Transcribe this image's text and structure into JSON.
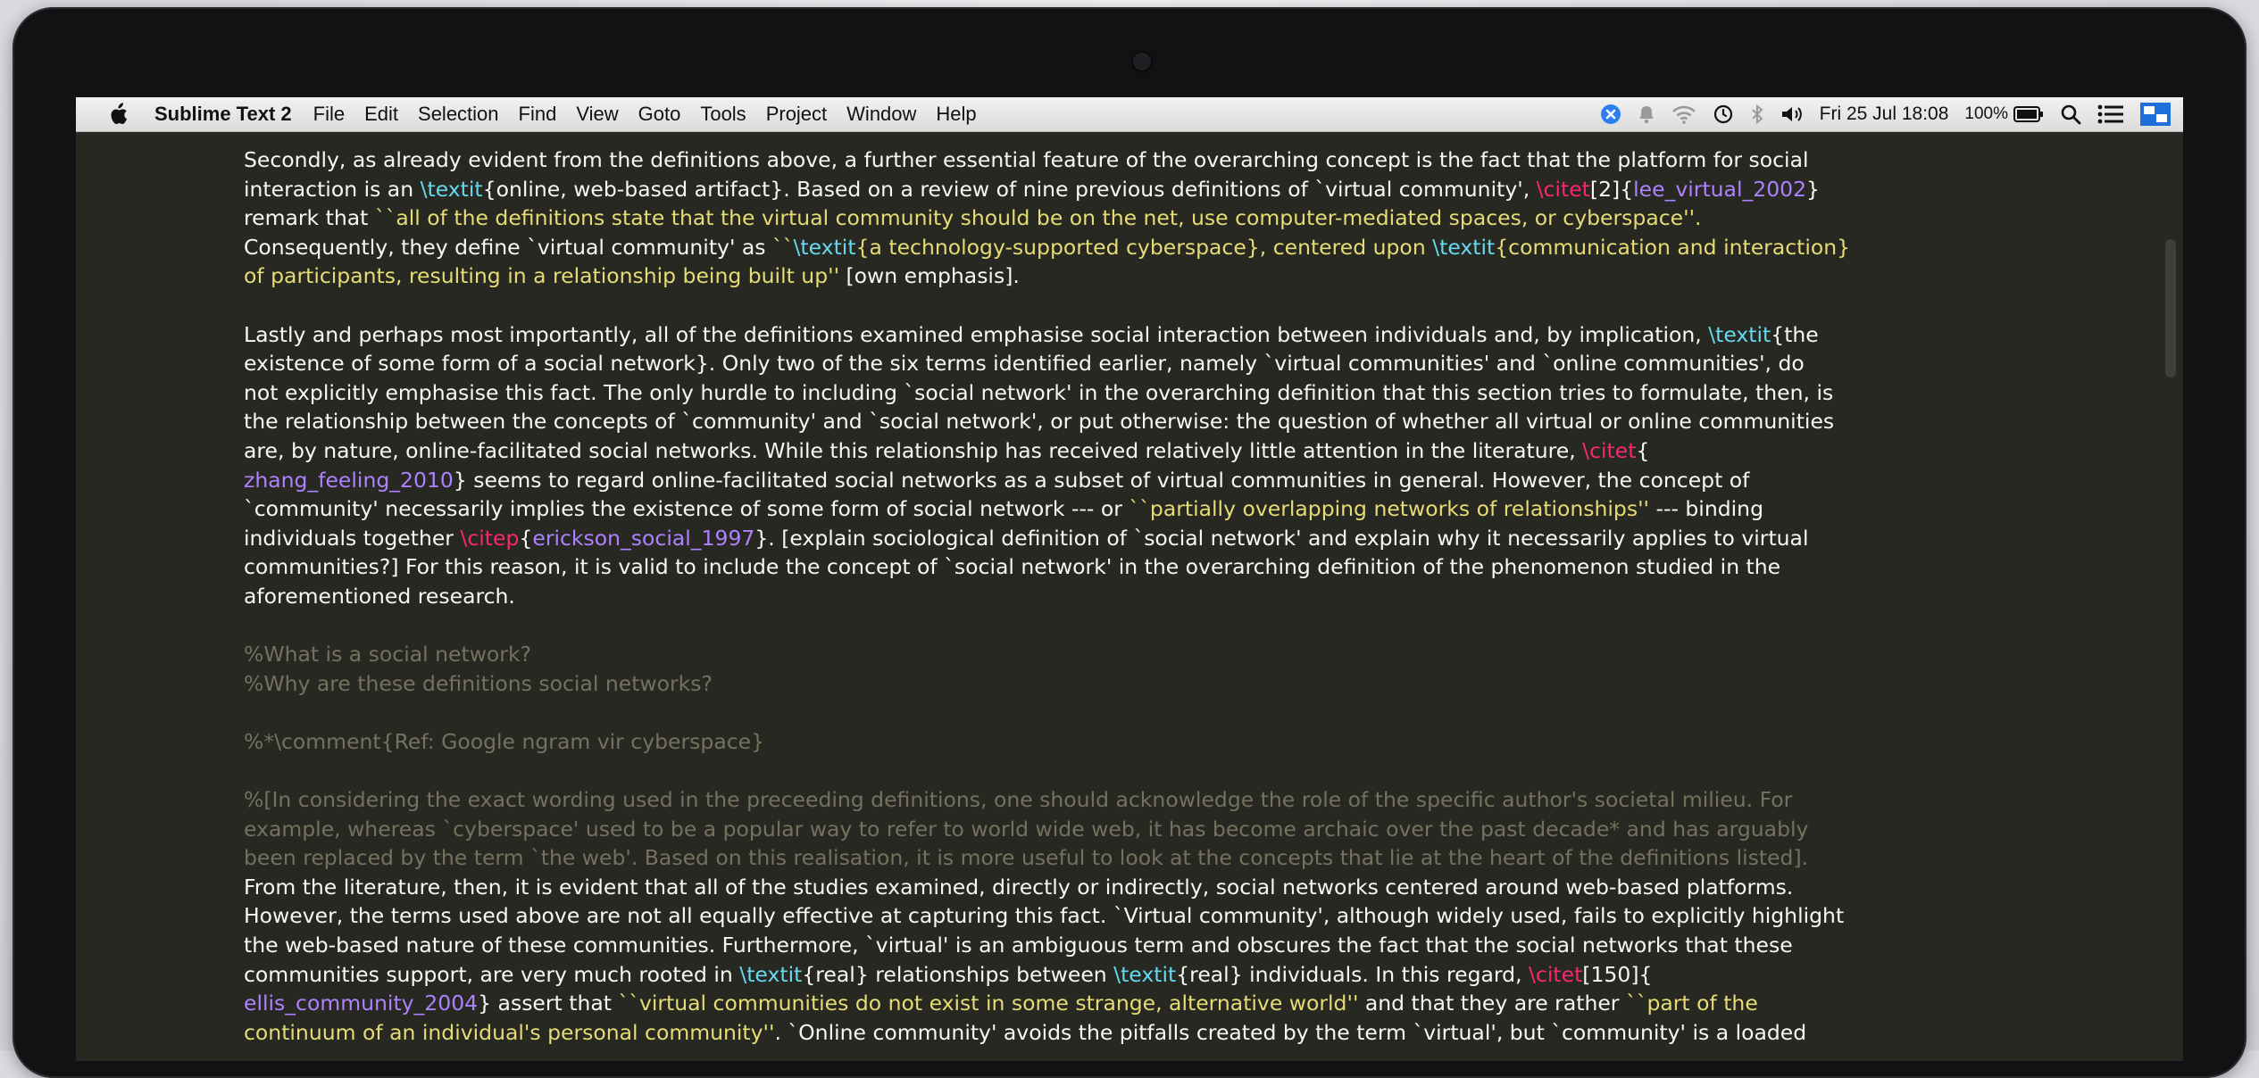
{
  "menubar": {
    "app_name": "Sublime Text 2",
    "items": [
      "File",
      "Edit",
      "Selection",
      "Find",
      "View",
      "Goto",
      "Tools",
      "Project",
      "Window",
      "Help"
    ],
    "clock": "Fri 25 Jul  18:08",
    "battery": "100%"
  },
  "editor": {
    "paragraphs": [
      [
        [
          {
            "t": "text",
            "v": "Secondly, as already evident from the definitions above, a further essential feature of the overarching concept is the fact that the platform for social"
          }
        ],
        [
          {
            "t": "text",
            "v": "interaction is an "
          },
          {
            "t": "cmd",
            "v": "\\textit"
          },
          {
            "t": "text",
            "v": "{online, web-based artifact}. Based on a review of nine previous definitions of `virtual community', "
          },
          {
            "t": "cite",
            "v": "\\citet"
          },
          {
            "t": "text",
            "v": "[2]{"
          },
          {
            "t": "key",
            "v": "lee_virtual_2002"
          },
          {
            "t": "text",
            "v": "}"
          }
        ],
        [
          {
            "t": "text",
            "v": "remark that "
          },
          {
            "t": "str",
            "v": "``all of the definitions state that the virtual community should be on the net, use computer-mediated spaces, or cyberspace''."
          }
        ],
        [
          {
            "t": "text",
            "v": "Consequently, they define `virtual community' as "
          },
          {
            "t": "str",
            "v": "``"
          },
          {
            "t": "cmd",
            "v": "\\textit"
          },
          {
            "t": "str",
            "v": "{a technology-supported cyberspace}, centered upon "
          },
          {
            "t": "cmd",
            "v": "\\textit"
          },
          {
            "t": "str",
            "v": "{communication and interaction}"
          }
        ],
        [
          {
            "t": "str",
            "v": "of participants, resulting in a relationship being built up''"
          },
          {
            "t": "text",
            "v": " [own emphasis]."
          }
        ]
      ],
      [
        [
          {
            "t": "text",
            "v": "Lastly and perhaps most importantly, all of the definitions examined emphasise social interaction between individuals and, by implication, "
          },
          {
            "t": "cmd",
            "v": "\\textit"
          },
          {
            "t": "text",
            "v": "{the"
          }
        ],
        [
          {
            "t": "text",
            "v": "existence of some form of a social network}. Only two of the six terms identified earlier, namely `virtual communities' and `online communities', do"
          }
        ],
        [
          {
            "t": "text",
            "v": "not explicitly emphasise this fact. The only hurdle to including `social network' in the overarching definition that this section tries to formulate, then, is"
          }
        ],
        [
          {
            "t": "text",
            "v": "the relationship between the concepts of `community' and `social network', or put otherwise: the question of whether all virtual or online communities"
          }
        ],
        [
          {
            "t": "text",
            "v": "are, by nature, online-facilitated social networks. While this relationship has received relatively little attention in the literature, "
          },
          {
            "t": "cite",
            "v": "\\citet"
          },
          {
            "t": "text",
            "v": "{"
          }
        ],
        [
          {
            "t": "key",
            "v": "zhang_feeling_2010"
          },
          {
            "t": "text",
            "v": "} seems to regard online-facilitated social networks as a subset of virtual communities in general. However, the concept of"
          }
        ],
        [
          {
            "t": "text",
            "v": "`community' necessarily implies the existence of some form of social network --- or "
          },
          {
            "t": "str",
            "v": "``partially overlapping networks of relationships''"
          },
          {
            "t": "text",
            "v": " --- binding"
          }
        ],
        [
          {
            "t": "text",
            "v": "individuals together "
          },
          {
            "t": "cite",
            "v": "\\citep"
          },
          {
            "t": "text",
            "v": "{"
          },
          {
            "t": "key",
            "v": "erickson_social_1997"
          },
          {
            "t": "text",
            "v": "}. [explain sociological definition of `social network' and explain why it necessarily applies to virtual"
          }
        ],
        [
          {
            "t": "text",
            "v": "communities?] For this reason, it is valid to include the concept of `social network' in the overarching definition of the phenomenon studied in the"
          }
        ],
        [
          {
            "t": "text",
            "v": "aforementioned research."
          }
        ]
      ],
      [
        [
          {
            "t": "comment",
            "v": "%What is a social network?"
          }
        ],
        [
          {
            "t": "comment",
            "v": "%Why are these definitions social networks?"
          }
        ]
      ],
      [
        [
          {
            "t": "comment",
            "v": "%*\\comment{Ref: Google ngram vir cyberspace}"
          }
        ]
      ],
      [
        [
          {
            "t": "comment",
            "v": "%[In considering the exact wording used in the preceeding definitions, one should acknowledge the role of the specific author's societal milieu. For"
          }
        ],
        [
          {
            "t": "comment",
            "v": "example, whereas `cyberspace' used to be a popular way to refer to world wide web, it has become archaic over the past decade* and has arguably"
          }
        ],
        [
          {
            "t": "comment",
            "v": "been replaced by the term `the web'. Based on this realisation, it is more useful to look at the concepts that lie at the heart of the definitions listed]."
          }
        ],
        [
          {
            "t": "text",
            "v": "From the literature, then, it is evident that all of the studies examined, directly or indirectly, social networks centered around web-based platforms."
          }
        ],
        [
          {
            "t": "text",
            "v": "However, the terms used above are not all equally effective at capturing this fact. `Virtual community', although widely used, fails to explicitly highlight"
          }
        ],
        [
          {
            "t": "text",
            "v": "the web-based nature of these communities. Furthermore, `virtual' is an ambiguous term and obscures the fact that the social networks that these"
          }
        ],
        [
          {
            "t": "text",
            "v": "communities support, are very much rooted in "
          },
          {
            "t": "cmd",
            "v": "\\textit"
          },
          {
            "t": "text",
            "v": "{real} relationships between "
          },
          {
            "t": "cmd",
            "v": "\\textit"
          },
          {
            "t": "text",
            "v": "{real} individuals. In this regard, "
          },
          {
            "t": "cite",
            "v": "\\citet"
          },
          {
            "t": "text",
            "v": "[150]{"
          }
        ],
        [
          {
            "t": "key",
            "v": "ellis_community_2004"
          },
          {
            "t": "text",
            "v": "} assert that "
          },
          {
            "t": "str",
            "v": "``virtual communities do not exist in some strange, alternative world''"
          },
          {
            "t": "text",
            "v": " and that they are rather "
          },
          {
            "t": "str",
            "v": "``part of the"
          }
        ],
        [
          {
            "t": "str",
            "v": "continuum of an individual's personal community''"
          },
          {
            "t": "text",
            "v": ". `Online community' avoids the pitfalls created by the term `virtual', but `community' is a loaded"
          }
        ]
      ]
    ]
  }
}
